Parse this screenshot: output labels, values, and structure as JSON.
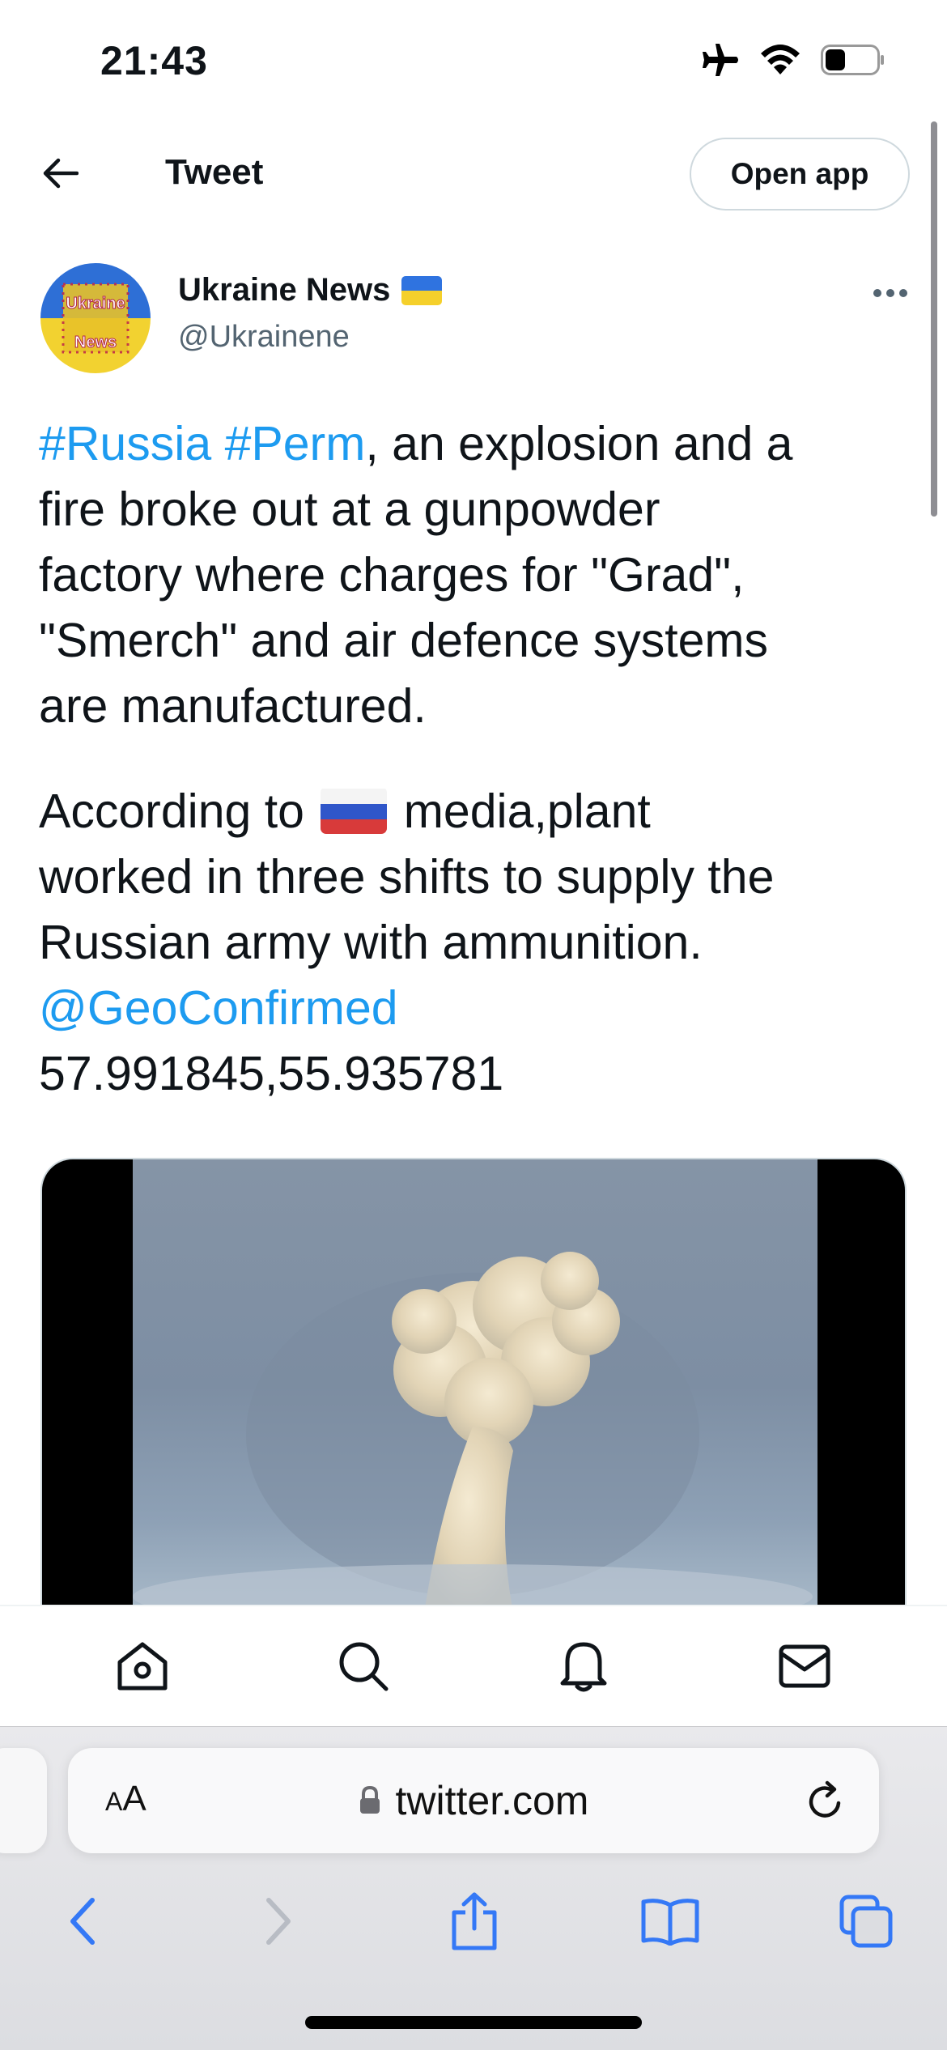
{
  "status_bar": {
    "time": "21:43",
    "icons": [
      "airplane-mode-icon",
      "wifi-icon",
      "battery-icon"
    ]
  },
  "header": {
    "title": "Tweet",
    "back_icon": "arrow-left-icon",
    "open_app_label": "Open app"
  },
  "tweet": {
    "author": {
      "name": "Ukraine News",
      "handle": "@Ukrainene",
      "avatar_text_top": "Ukraine",
      "avatar_text_bottom": "News"
    },
    "text": {
      "hashtag_russia": "#Russia",
      "hashtag_perm": "#Perm",
      "line1_rest": ", an explosion and a",
      "line2": "fire broke out at a gunpowder",
      "line3": "factory where charges for \"Grad\",",
      "line4": "\"Smerch\" and air defence systems",
      "line5": "are manufactured.",
      "line6_before_flag": "According to",
      "line6_after_flag": "media,plant",
      "line7": "worked in three shifts to supply the",
      "line8": "Russian army with ammunition.",
      "mention": "@GeoConfirmed",
      "coordinates": "57.991845,55.935781"
    }
  },
  "bottom_nav": {
    "items": [
      "home-icon",
      "search-icon",
      "notifications-icon",
      "messages-icon"
    ]
  },
  "safari": {
    "aa_label_small": "A",
    "aa_label_large": "A",
    "url": "twitter.com",
    "toolbar": [
      "back-icon",
      "forward-icon",
      "share-icon",
      "bookmarks-icon",
      "tabs-icon"
    ]
  },
  "colors": {
    "link": "#1d9bf0",
    "safari_accent": "#3478f6",
    "handle_gray": "#536471"
  }
}
